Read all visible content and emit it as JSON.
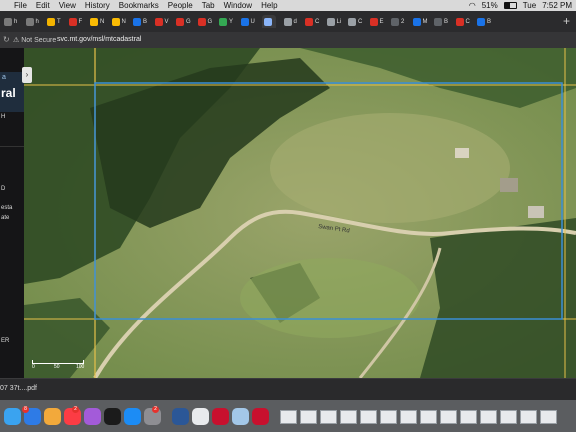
{
  "menubar": {
    "app": "Chrome",
    "menus": [
      "File",
      "Edit",
      "View",
      "History",
      "Bookmarks",
      "People",
      "Tab",
      "Window",
      "Help"
    ],
    "battery": "51%",
    "day": "Tue",
    "time": "7:52 PM"
  },
  "tabs": [
    {
      "label": "h",
      "color": "#7a7a7a"
    },
    {
      "label": "h",
      "color": "#7a7a7a"
    },
    {
      "label": "T",
      "color": "#f4b400"
    },
    {
      "label": "F",
      "color": "#d93025"
    },
    {
      "label": "N",
      "color": "#fbbc04"
    },
    {
      "label": "N",
      "color": "#fbbc04"
    },
    {
      "label": "B",
      "color": "#1a73e8"
    },
    {
      "label": "V",
      "color": "#d93025"
    },
    {
      "label": "G",
      "color": "#d93025"
    },
    {
      "label": "G",
      "color": "#d93025"
    },
    {
      "label": "Y",
      "color": "#34a853"
    },
    {
      "label": "U",
      "color": "#1a73e8"
    },
    {
      "label": "",
      "color": "#8ab4f8"
    },
    {
      "label": "d",
      "color": "#9aa0a6"
    },
    {
      "label": "C",
      "color": "#d93025"
    },
    {
      "label": "Li",
      "color": "#9aa0a6"
    },
    {
      "label": "C",
      "color": "#9aa0a6"
    },
    {
      "label": "E",
      "color": "#d93025"
    },
    {
      "label": "2",
      "color": "#5f6368"
    },
    {
      "label": "M",
      "color": "#1a73e8"
    },
    {
      "label": "B",
      "color": "#5f6368"
    },
    {
      "label": "C",
      "color": "#d93025"
    },
    {
      "label": "B",
      "color": "#1a73e8"
    }
  ],
  "address": {
    "secure_label": "Not Secure",
    "url": "svc.mt.gov/msl/mtcadastral"
  },
  "sidebar": {
    "brand_top": "a",
    "brand_main": "ral",
    "items": [
      "H",
      "D",
      "esta",
      "ate",
      "ER"
    ]
  },
  "map": {
    "road_label": "Swan Pt Rd",
    "scale_labels": [
      "0",
      "50",
      "100"
    ],
    "parcel_line_color": "#3a8fd6",
    "section_line_color": "#e7c14a"
  },
  "downloads": {
    "file": "07 37t....pdf"
  },
  "dock": {
    "apps": [
      {
        "name": "finder",
        "color": "#3aa3f0"
      },
      {
        "name": "safari",
        "color": "#2e7be6"
      },
      {
        "name": "photos",
        "color": "#f2a93b"
      },
      {
        "name": "music",
        "color": "#fc3c44"
      },
      {
        "name": "podcasts",
        "color": "#a35bd9"
      },
      {
        "name": "tv",
        "color": "#1b1b1b"
      },
      {
        "name": "app-store",
        "color": "#1c8cf5"
      },
      {
        "name": "system-preferences",
        "color": "#8e8e93"
      },
      {
        "name": "word",
        "color": "#2b5797"
      },
      {
        "name": "chrome",
        "color": "#e8eaed"
      },
      {
        "name": "acrobat",
        "color": "#c8102e"
      },
      {
        "name": "preview",
        "color": "#a3c7e8"
      },
      {
        "name": "acrobat-2",
        "color": "#c8102e"
      }
    ],
    "badges": [
      "8",
      "2",
      "2"
    ]
  }
}
